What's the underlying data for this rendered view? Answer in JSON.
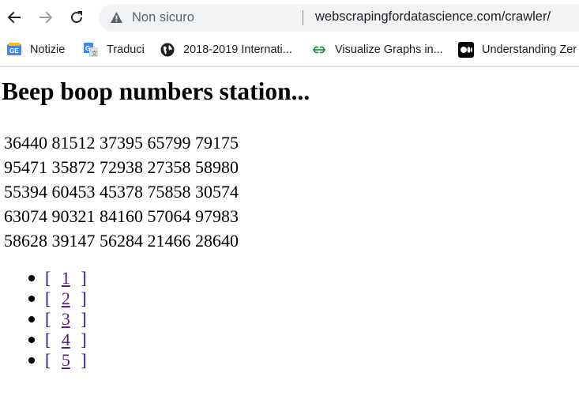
{
  "browser": {
    "not_secure_label": "Non sicuro",
    "url": "webscrapingfordatascience.com/crawler/"
  },
  "bookmarks": [
    {
      "label": "Notizie",
      "icon": "google-news-icon"
    },
    {
      "label": "Traduci",
      "icon": "google-translate-icon"
    },
    {
      "label": "2018-2019 Internati...",
      "icon": "globe-icon"
    },
    {
      "label": "Visualize Graphs in...",
      "icon": "geeksforgeeks-icon"
    },
    {
      "label": "Understanding Zer",
      "icon": "medium-icon"
    }
  ],
  "page": {
    "title": "Beep boop numbers station...",
    "rows": [
      "36440 81512 37395 65799 79175",
      "95471 35872 72938 27358 58980",
      "55394 60453 45378 75858 30574",
      "63074 90321 84160 57064 97983",
      "58628 39147 56284 21466 28640"
    ],
    "links": [
      {
        "open": "[",
        "label": "1",
        "close": "]"
      },
      {
        "open": "[",
        "label": "2",
        "close": "]"
      },
      {
        "open": "[",
        "label": "3",
        "close": "]"
      },
      {
        "open": "[",
        "label": "4",
        "close": "]"
      },
      {
        "open": "[",
        "label": "5",
        "close": "]"
      }
    ]
  },
  "colors": {
    "link": "#1a0dab",
    "visited_link": "#551a8b",
    "omnibox_bg": "#f1f3f4"
  }
}
